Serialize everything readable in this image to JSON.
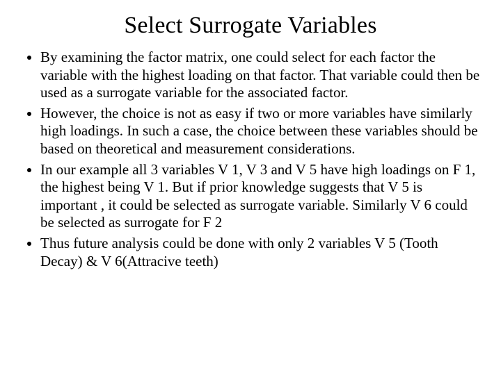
{
  "slide": {
    "title": "Select Surrogate Variables",
    "bullets": [
      "By examining the factor matrix, one could select for each factor the variable with the highest loading on that factor.  That variable could then be used as a surrogate variable for the associated factor.",
      "However, the choice is not as easy if two or more variables have similarly high loadings.  In such a case, the choice between these variables should be based on theoretical and measurement considerations.",
      "In our example all 3 variables V 1, V 3 and V 5 have high loadings on F 1, the highest being V 1. But if prior knowledge suggests that V 5 is important , it could be selected as surrogate variable. Similarly V 6 could be selected as surrogate for F 2",
      "Thus future analysis could be done with only 2 variables V 5 (Tooth Decay) & V 6(Attracive teeth)"
    ]
  }
}
